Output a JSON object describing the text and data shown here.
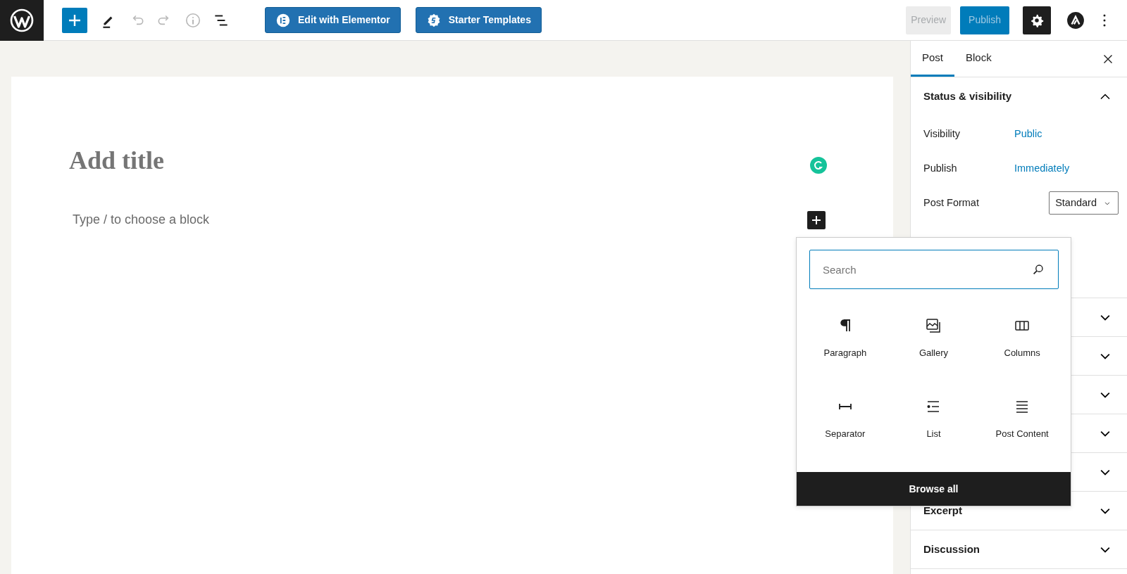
{
  "toolbar": {
    "logo": {
      "kind": "wordpress"
    },
    "inserter_toggle": {
      "pressed": true
    },
    "tools": [
      {
        "kind": "edit",
        "disabled": false
      },
      {
        "kind": "undo",
        "disabled": true
      },
      {
        "kind": "redo",
        "disabled": true
      },
      {
        "kind": "info",
        "disabled": true
      },
      {
        "kind": "outline",
        "disabled": false
      }
    ],
    "buttons": [
      {
        "label": "Edit with Elementor",
        "kind": "elementor"
      },
      {
        "label": "Starter Templates",
        "kind": "starter"
      }
    ],
    "preview": {
      "label": "Preview"
    },
    "publish": {
      "label": "Publish"
    },
    "settings": {
      "pressed": true
    }
  },
  "editor": {
    "title_placeholder": "Add title",
    "block_placeholder": "Type / to choose a block"
  },
  "sidebar": {
    "tabs": [
      {
        "label": "Post",
        "selected": true
      },
      {
        "label": "Block",
        "selected": false
      }
    ],
    "panels": [
      {
        "title": "Status & visibility",
        "expanded": true,
        "rows": [
          {
            "kind": "link",
            "label": "Visibility",
            "value": "Public"
          },
          {
            "kind": "link",
            "label": "Publish",
            "value": "Immediately"
          },
          {
            "kind": "select",
            "label": "Post Format",
            "value": "Standard"
          }
        ]
      },
      {
        "expanded": false
      },
      {
        "expanded": false
      },
      {
        "expanded": false
      },
      {
        "expanded": false
      },
      {
        "expanded": false
      },
      {
        "title": "Excerpt",
        "expanded": false
      },
      {
        "title": "Discussion",
        "expanded": false
      }
    ]
  },
  "inserter": {
    "search": {
      "placeholder": "Search"
    },
    "blocks": [
      {
        "label": "Paragraph",
        "kind": "paragraph"
      },
      {
        "label": "Gallery",
        "kind": "gallery"
      },
      {
        "label": "Columns",
        "kind": "columns"
      },
      {
        "label": "Separator",
        "kind": "separator"
      },
      {
        "label": "List",
        "kind": "list"
      },
      {
        "label": "Post Content",
        "kind": "post-content"
      }
    ],
    "browse_all": "Browse all"
  }
}
